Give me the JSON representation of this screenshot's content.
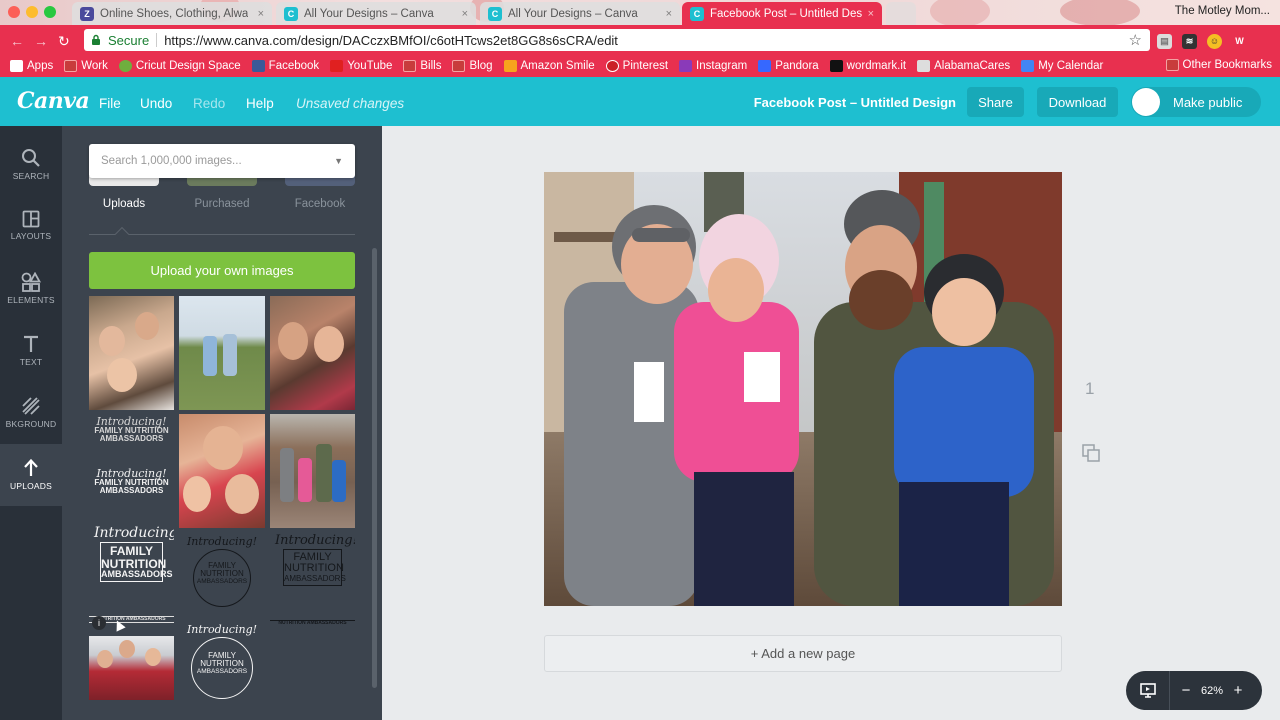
{
  "browser": {
    "tabs": [
      {
        "title": "Online Shoes, Clothing, Alwa",
        "icon": "zappos-icon",
        "color": "#4a4a9c"
      },
      {
        "title": "All Your Designs – Canva",
        "icon": "canva-icon",
        "color": "#1ebfd0"
      },
      {
        "title": "All Your Designs – Canva",
        "icon": "canva-icon",
        "color": "#1ebfd0"
      },
      {
        "title": "Facebook Post – Untitled Desi",
        "icon": "canva-icon",
        "color": "#1ebfd0",
        "active": true
      }
    ],
    "profile_name": "The Motley Mom...",
    "secure_label": "Secure",
    "url": "https://www.canva.com/design/DACczxBMfOI/c6otHTcws2et8GG8s6sCRA/edit",
    "bookmarks": [
      {
        "label": "Apps",
        "icon": "apps-icon",
        "color": "#ffffff"
      },
      {
        "label": "Work",
        "icon": "folder-icon",
        "color": "#c83c3c"
      },
      {
        "label": "Cricut Design Space",
        "icon": "cricut-icon",
        "color": "#6fae3e"
      },
      {
        "label": "Facebook",
        "icon": "facebook-icon",
        "color": "#3b5998"
      },
      {
        "label": "YouTube",
        "icon": "youtube-icon",
        "color": "#e02020"
      },
      {
        "label": "Bills",
        "icon": "folder-icon",
        "color": "#c83c3c"
      },
      {
        "label": "Blog",
        "icon": "folder-icon",
        "color": "#c83c3c"
      },
      {
        "label": "Amazon Smile",
        "icon": "amazon-icon",
        "color": "#f7a41d"
      },
      {
        "label": "Pinterest",
        "icon": "pinterest-icon",
        "color": "#cb2027"
      },
      {
        "label": "Instagram",
        "icon": "instagram-icon",
        "color": "#8a3ab9"
      },
      {
        "label": "Pandora",
        "icon": "pandora-icon",
        "color": "#3668ff"
      },
      {
        "label": "wordmark.it",
        "icon": "wordmark-icon",
        "color": "#111111"
      },
      {
        "label": "AlabamaCares",
        "icon": "page-icon",
        "color": "#dddddd"
      },
      {
        "label": "My Calendar",
        "icon": "calendar-icon",
        "color": "#4285f4"
      }
    ],
    "other_bookmarks": "Other Bookmarks"
  },
  "header": {
    "logo": "Canva",
    "menu": {
      "file": "File",
      "undo": "Undo",
      "redo": "Redo",
      "help": "Help",
      "status": "Unsaved changes"
    },
    "document_title": "Facebook Post – Untitled Design",
    "share": "Share",
    "download": "Download",
    "make_public": "Make public"
  },
  "rail": [
    {
      "label": "SEARCH",
      "icon": "search-icon"
    },
    {
      "label": "LAYOUTS",
      "icon": "layouts-icon"
    },
    {
      "label": "ELEMENTS",
      "icon": "elements-icon"
    },
    {
      "label": "TEXT",
      "icon": "text-icon"
    },
    {
      "label": "BKGROUND",
      "icon": "background-icon"
    },
    {
      "label": "UPLOADS",
      "icon": "upload-icon",
      "active": true
    }
  ],
  "panel": {
    "search_placeholder": "Search 1,000,000 images...",
    "subtabs": [
      "Uploads",
      "Purchased",
      "Facebook"
    ],
    "upload_button": "Upload your own images",
    "graphic_text": {
      "introducing": "Introducing!",
      "line1": "FAMILY",
      "line2": "NUTRITION",
      "line3": "AMBASSADORS",
      "line_combined": "FAMILY NUTRITION",
      "small_strip": "NUTRITION AMBASSADORS"
    }
  },
  "canvas": {
    "page_number": "1",
    "add_page": "+ Add a new page",
    "zoom": "62%"
  },
  "colors": {
    "canva_teal": "#1ebfd0",
    "chrome_red": "#e8304f",
    "upload_green": "#7dc23f",
    "rail_dark": "#293039",
    "panel_dark": "#3c444e"
  }
}
